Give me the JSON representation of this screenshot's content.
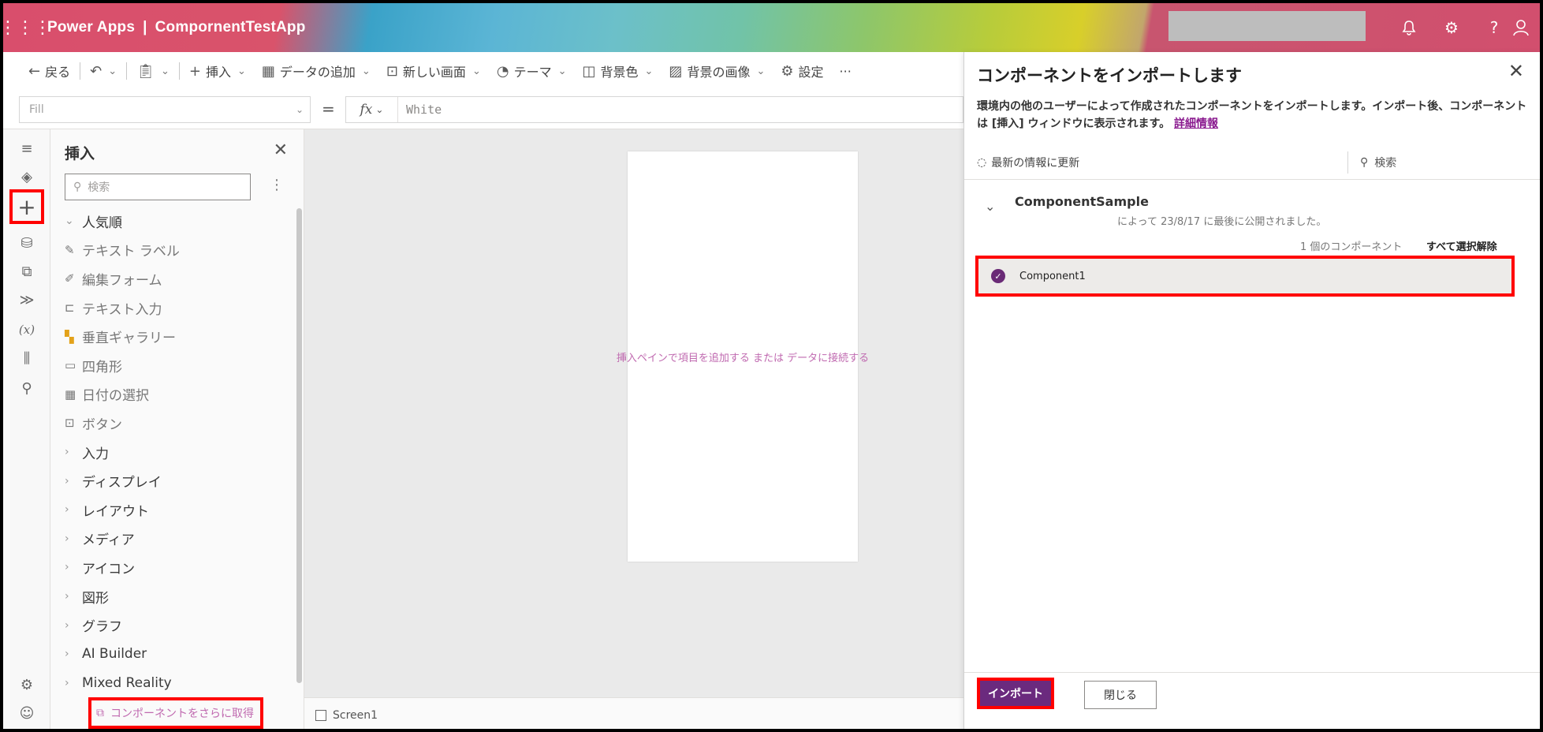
{
  "topbar": {
    "app_name": "Power Apps",
    "divider": "|",
    "app_file": "CompornentTestApp",
    "icons": [
      "waffle-icon",
      "bell-icon",
      "gear-icon",
      "help-icon",
      "user-icon"
    ]
  },
  "commandbar": {
    "back": "戻る",
    "insert": "挿入",
    "add_data": "データの追加",
    "new_screen": "新しい画面",
    "theme": "テーマ",
    "background_color": "背景色",
    "background_image": "背景の画像",
    "settings": "設定",
    "more": "···"
  },
  "formulabar": {
    "property": "Fill",
    "equals": "=",
    "fx": "fx",
    "value": "White"
  },
  "insert_pane": {
    "title": "挿入",
    "search_placeholder": "検索",
    "popular": "人気順",
    "items": [
      {
        "label": "テキスト ラベル",
        "icon": "label-icon"
      },
      {
        "label": "編集フォーム",
        "icon": "form-icon"
      },
      {
        "label": "テキスト入力",
        "icon": "text-input-icon"
      },
      {
        "label": "垂直ギャラリー",
        "icon": "gallery-icon"
      },
      {
        "label": "四角形",
        "icon": "rectangle-icon"
      },
      {
        "label": "日付の選択",
        "icon": "calendar-icon"
      },
      {
        "label": "ボタン",
        "icon": "button-icon"
      }
    ],
    "categories": [
      "入力",
      "ディスプレイ",
      "レイアウト",
      "メディア",
      "アイコン",
      "図形",
      "グラフ",
      "AI Builder",
      "Mixed Reality"
    ],
    "get_more": "コンポーネントをさらに取得"
  },
  "canvas": {
    "hint": "挿入ペインで項目を追加する または データに接続する",
    "screen_name": "Screen1"
  },
  "panel": {
    "title": "コンポーネントをインポートします",
    "description": "環境内の他のユーザーによって作成されたコンポーネントをインポートします。インポート後、コンポーネントは [挿入] ウィンドウに表示されます。",
    "link": "詳細情報",
    "refresh": "最新の情報に更新",
    "search": "検索",
    "group_name": "ComponentSample",
    "group_meta": "によって 23/8/17 に最後に公開されました。",
    "count": "1 個のコンポーネント",
    "deselect_all": "すべて選択解除",
    "component": "Component1",
    "import_button": "インポート",
    "close_button": "閉じる"
  },
  "colors": {
    "accent": "#6b2a7e",
    "highlight": "#ff0000",
    "hint_text": "#c06ab0"
  }
}
